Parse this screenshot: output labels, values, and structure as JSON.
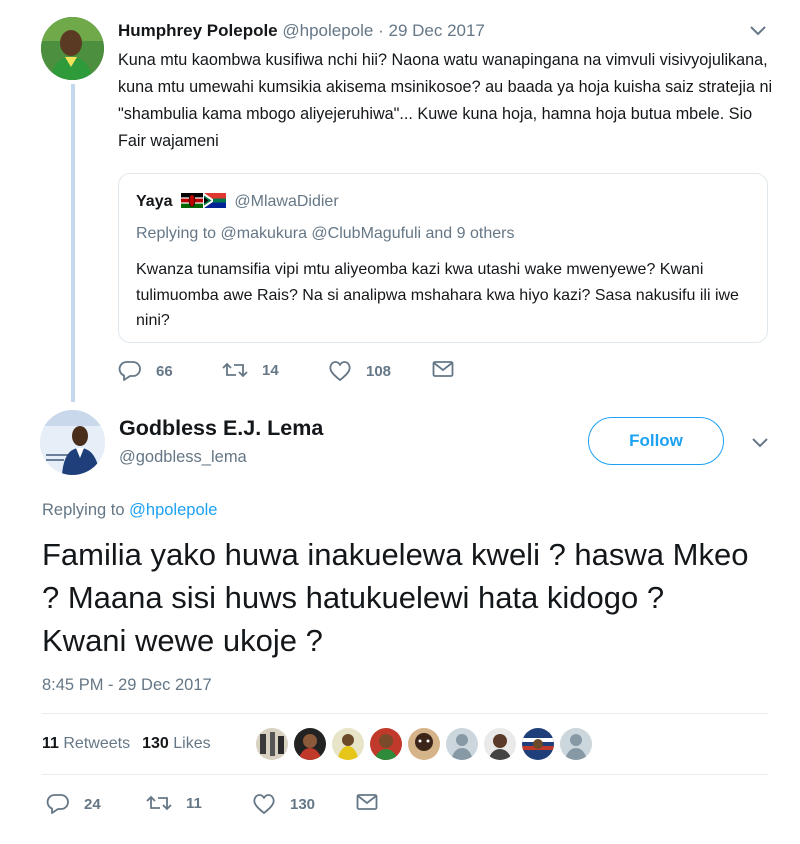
{
  "tweet1": {
    "name": "Humphrey Polepole",
    "handle": "@hpolepole",
    "separator": " · ",
    "date": "29 Dec 2017",
    "text": "Kuna mtu kaombwa kusifiwa nchi hii? Naona watu wanapingana na vimvuli visivyojulikana, kuna mtu umewahi kumsikia akisema msinikosoe? au baada ya hoja kuisha saiz stratejia ni \"shambulia kama mbogo aliyejeruhiwa\"... Kuwe kuna hoja, hamna hoja butua mbele. Sio Fair wajameni",
    "quoted": {
      "name": "Yaya",
      "flags": [
        "kenya-flag",
        "south-africa-flag"
      ],
      "handle": "@MlawaDidier",
      "replying": "Replying to @makukura @ClubMagufuli and 9 others",
      "text": "Kwanza tunamsifia vipi mtu aliyeomba kazi kwa utashi wake mwenyewe? Kwani tulimuomba awe Rais? Na si analipwa mshahara kwa hiyo kazi? Sasa nakusifu ili iwe nini?"
    },
    "actions": {
      "replies": "66",
      "retweets": "14",
      "likes": "108"
    }
  },
  "tweet2": {
    "name": "Godbless E.J. Lema",
    "handle": "@godbless_lema",
    "follow_label": "Follow",
    "replying_prefix": "Replying to ",
    "replying_to": "@hpolepole",
    "text": "Familia yako huwa inakuelewa kweli ? haswa Mkeo ? Maana sisi huws hatukuelewi hata kidogo ?    Kwani wewe ukoje ?",
    "timestamp": "8:45 PM - 29 Dec 2017",
    "retweet_count": "11",
    "retweet_label": "Retweets",
    "like_count": "130",
    "like_label": "Likes",
    "actions": {
      "replies": "24",
      "retweets": "11",
      "likes": "130"
    }
  },
  "colors": {
    "accent": "#1da1f2",
    "secondary_text": "#657786",
    "primary_text": "#14171a",
    "thread_line": "#c4d9ee",
    "border": "#e1e8ed"
  },
  "icons": [
    "reply-icon",
    "retweet-icon",
    "like-icon",
    "message-icon",
    "chevron-down-icon"
  ]
}
